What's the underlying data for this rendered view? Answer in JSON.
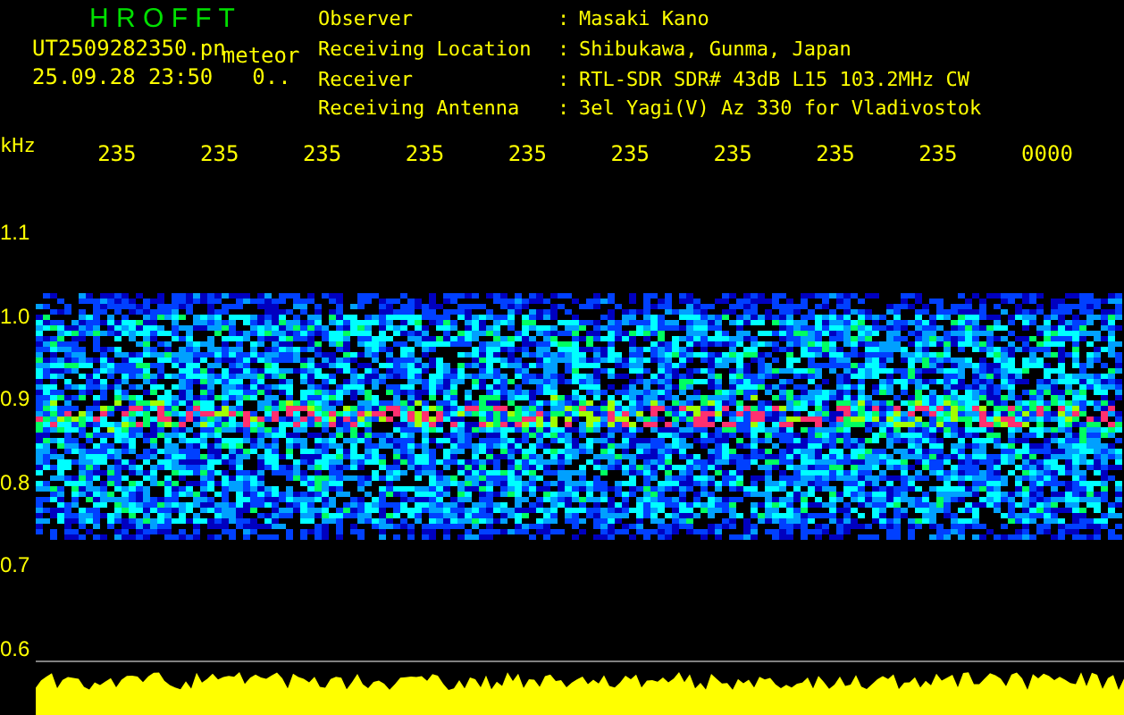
{
  "header": {
    "title": "H R O F F T",
    "filename": "UT2509282350.pn",
    "tag": "meteor",
    "datetime": "25.09.28 23:50",
    "counter": "0.."
  },
  "info": [
    {
      "label": "Observer",
      "separator": ":",
      "value": "Masaki Kano"
    },
    {
      "label": "Receiving Location",
      "separator": ":",
      "value": "Shibukawa, Gunma, Japan"
    },
    {
      "label": "Receiver",
      "separator": ":",
      "value": "RTL-SDR SDR# 43dB L15 103.2MHz CW"
    },
    {
      "label": "Receiving Antenna",
      "separator": ":",
      "value": "3el Yagi(V) Az 330 for Vladivostok"
    }
  ],
  "x_axis": {
    "unit": "kHz",
    "labels": [
      "235",
      "235",
      "235",
      "235",
      "235",
      "235",
      "235",
      "235",
      "235",
      "0000"
    ]
  },
  "y_axis": {
    "labels": [
      "1.1",
      "1.0",
      "0.9",
      "0.8",
      "0.7",
      "0.6"
    ]
  }
}
